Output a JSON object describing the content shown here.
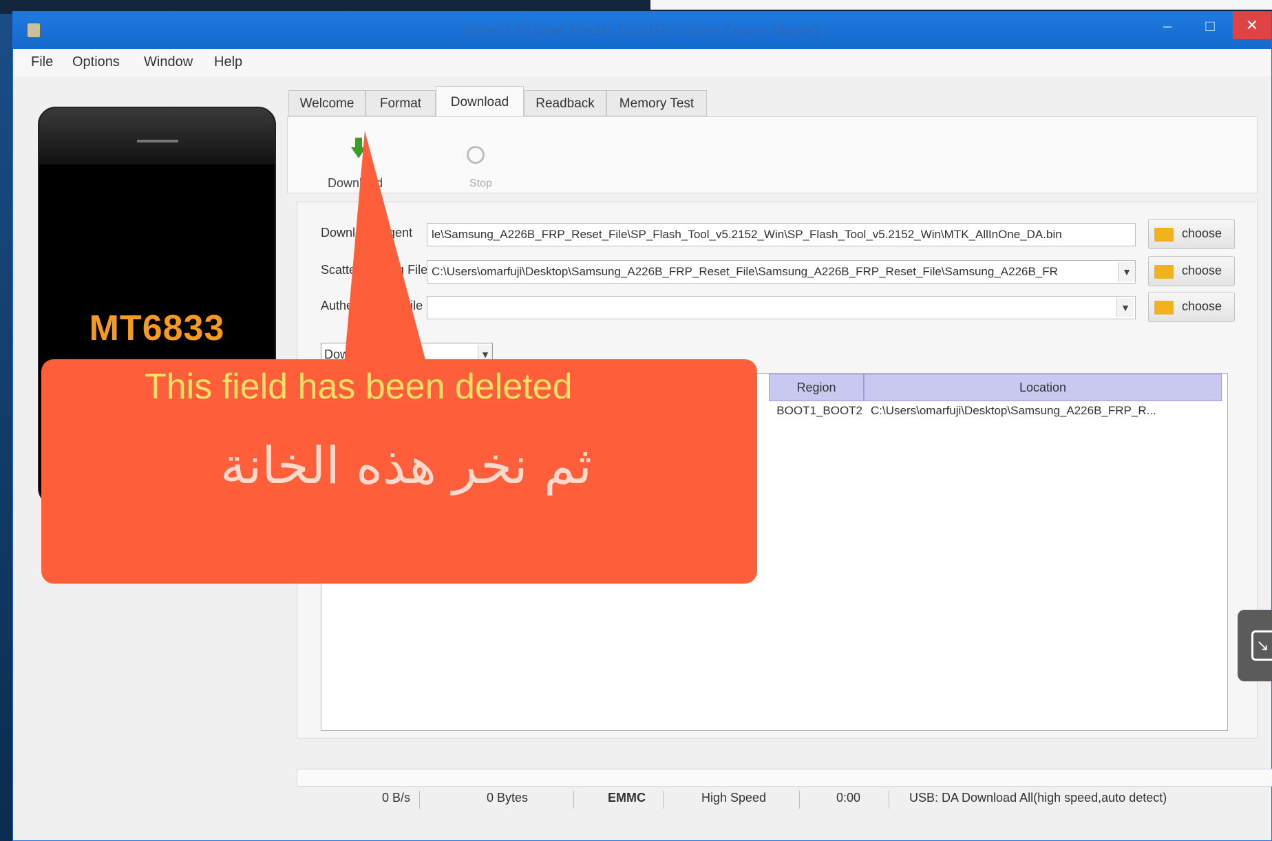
{
  "window": {
    "title": "Smart Phone Flash Tool(Runtime Trace Mode)",
    "minimize": "–",
    "maximize": "□",
    "close": "✕"
  },
  "menu": [
    "File",
    "Options",
    "Window",
    "Help"
  ],
  "device": {
    "chip": "MT6833"
  },
  "tabs": [
    "Welcome",
    "Format",
    "Download",
    "Readback",
    "Memory Test"
  ],
  "active_tab": "Download",
  "toolbar": {
    "download_label": "Download",
    "stop_label": "Stop"
  },
  "fields": {
    "download_agent_label": "Download-Agent",
    "download_agent_value": "le\\Samsung_A226B_FRP_Reset_File\\SP_Flash_Tool_v5.2152_Win\\SP_Flash_Tool_v5.2152_Win\\MTK_AllInOne_DA.bin",
    "scatter_label": "Scatter-loading File",
    "scatter_value": "C:\\Users\\omarfuji\\Desktop\\Samsung_A226B_FRP_Reset_File\\Samsung_A226B_FRP_Reset_File\\Samsung_A226B_FR",
    "auth_label": "Authentication File",
    "auth_value": "",
    "choose_label": "choose",
    "mode_value": "Download Only"
  },
  "table": {
    "headers": {
      "region": "Region",
      "location": "Location"
    },
    "rows": [
      {
        "region": "BOOT1_BOOT2",
        "location": "C:\\Users\\omarfuji\\Desktop\\Samsung_A226B_FRP_R..."
      }
    ]
  },
  "status": {
    "speed": "0 B/s",
    "bytes": "0 Bytes",
    "storage": "EMMC",
    "usb_speed": "High Speed",
    "time": "0:00",
    "usb_mode": "USB: DA Download All(high speed,auto detect)"
  },
  "callout": {
    "english": "This field has been deleted",
    "arabic": "ثم نخر هذه الخانة"
  },
  "colors": {
    "callout_bg": "#ff5e3a",
    "callout_en_text": "#ffe066",
    "chip_text": "#f59a1b",
    "titlebar": "#1f7ae0",
    "table_header": "#c8c8f0"
  }
}
